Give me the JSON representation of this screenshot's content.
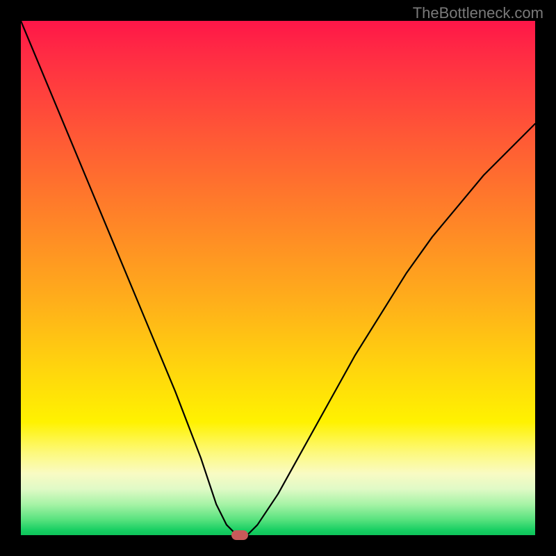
{
  "watermark": "TheBottleneck.com",
  "chart_data": {
    "type": "line",
    "title": "",
    "xlabel": "",
    "ylabel": "",
    "x": [
      0.0,
      0.05,
      0.1,
      0.15,
      0.2,
      0.25,
      0.3,
      0.35,
      0.38,
      0.4,
      0.42,
      0.44,
      0.46,
      0.5,
      0.55,
      0.6,
      0.65,
      0.7,
      0.75,
      0.8,
      0.85,
      0.9,
      0.95,
      1.0
    ],
    "values": [
      1.0,
      0.88,
      0.76,
      0.64,
      0.52,
      0.4,
      0.28,
      0.15,
      0.06,
      0.02,
      0.0,
      0.0,
      0.02,
      0.08,
      0.17,
      0.26,
      0.35,
      0.43,
      0.51,
      0.58,
      0.64,
      0.7,
      0.75,
      0.8
    ],
    "xlim": [
      0,
      1
    ],
    "ylim": [
      0,
      1
    ],
    "marker": {
      "x": 0.425,
      "y": 0.0
    },
    "background_gradient": {
      "top": "#ff1648",
      "mid": "#fff200",
      "bottom": "#0ec45a"
    }
  }
}
